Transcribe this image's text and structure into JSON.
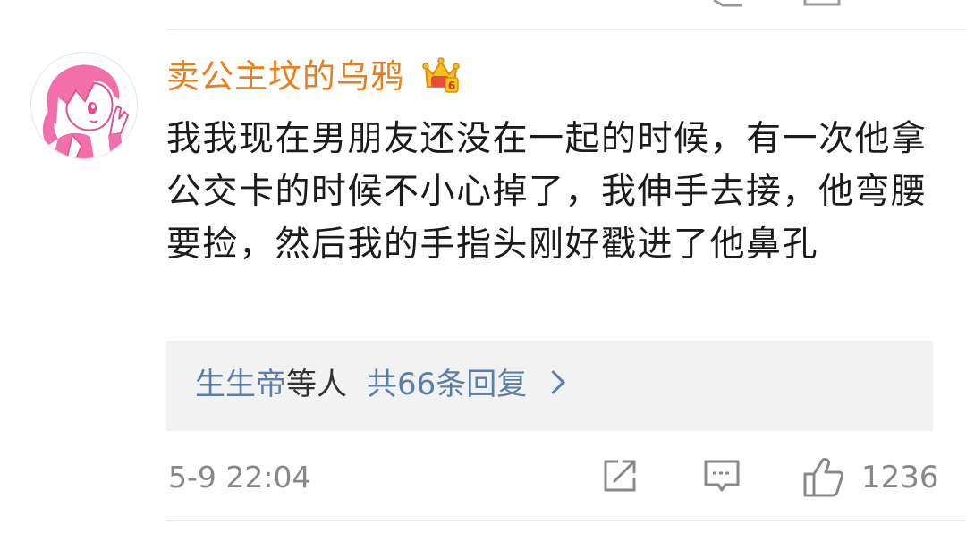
{
  "comment": {
    "username": "卖公主坟的乌鸦",
    "vip_badge_icon": "vip-crown-badge-icon",
    "avatar_icon": "anime-girl-avatar",
    "text": "我我现在男朋友还没在一起的时候，有一次他拿公交卡的时候不小心掉了，我伸手去接，他弯腰要捡，然后我的手指头刚好戳进了他鼻孔",
    "replies": {
      "names": "生生帝",
      "etc": "等人",
      "count_label": "共66条回复",
      "chevron_icon": "chevron-right-icon"
    },
    "timestamp": "5-9 22:04",
    "actions": {
      "share_icon": "share-icon",
      "comment_icon": "comment-icon",
      "like_icon": "thumbs-up-icon",
      "like_count": "1236"
    }
  },
  "colors": {
    "username": "#ea7e1b",
    "link_blue": "#5b7fa6",
    "meta_gray": "#888888",
    "reply_bg": "#f2f2f2"
  }
}
